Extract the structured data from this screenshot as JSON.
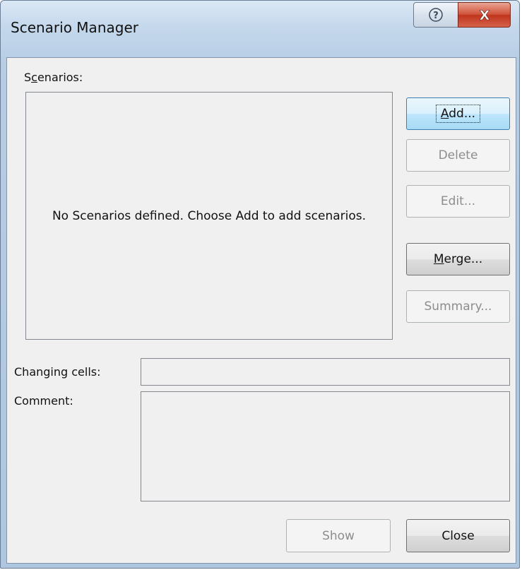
{
  "window": {
    "title": "Scenario Manager",
    "help_glyph": "?",
    "close_glyph": "X"
  },
  "scenarios": {
    "label_prefix": "S",
    "label_accel": "c",
    "label_suffix": "enarios:",
    "empty_message": "No Scenarios defined. Choose Add to add scenarios."
  },
  "buttons": {
    "add": {
      "accel": "A",
      "rest": "dd..."
    },
    "delete": "Delete",
    "edit": "Edit...",
    "merge": {
      "accel": "M",
      "rest": "erge..."
    },
    "summary": "Summary...",
    "show": "Show",
    "close": "Close"
  },
  "details": {
    "changing_cells_label": "Changing cells:",
    "changing_cells_value": "",
    "comment_label": "Comment:",
    "comment_value": ""
  },
  "colors": {
    "title_bar": "#c5d8ec",
    "close_button": "#c0351d",
    "dialog_body": "#f0f0f0",
    "default_button_border": "#3c7fb1"
  },
  "icons": {
    "help": "help-icon",
    "close": "close-icon"
  }
}
